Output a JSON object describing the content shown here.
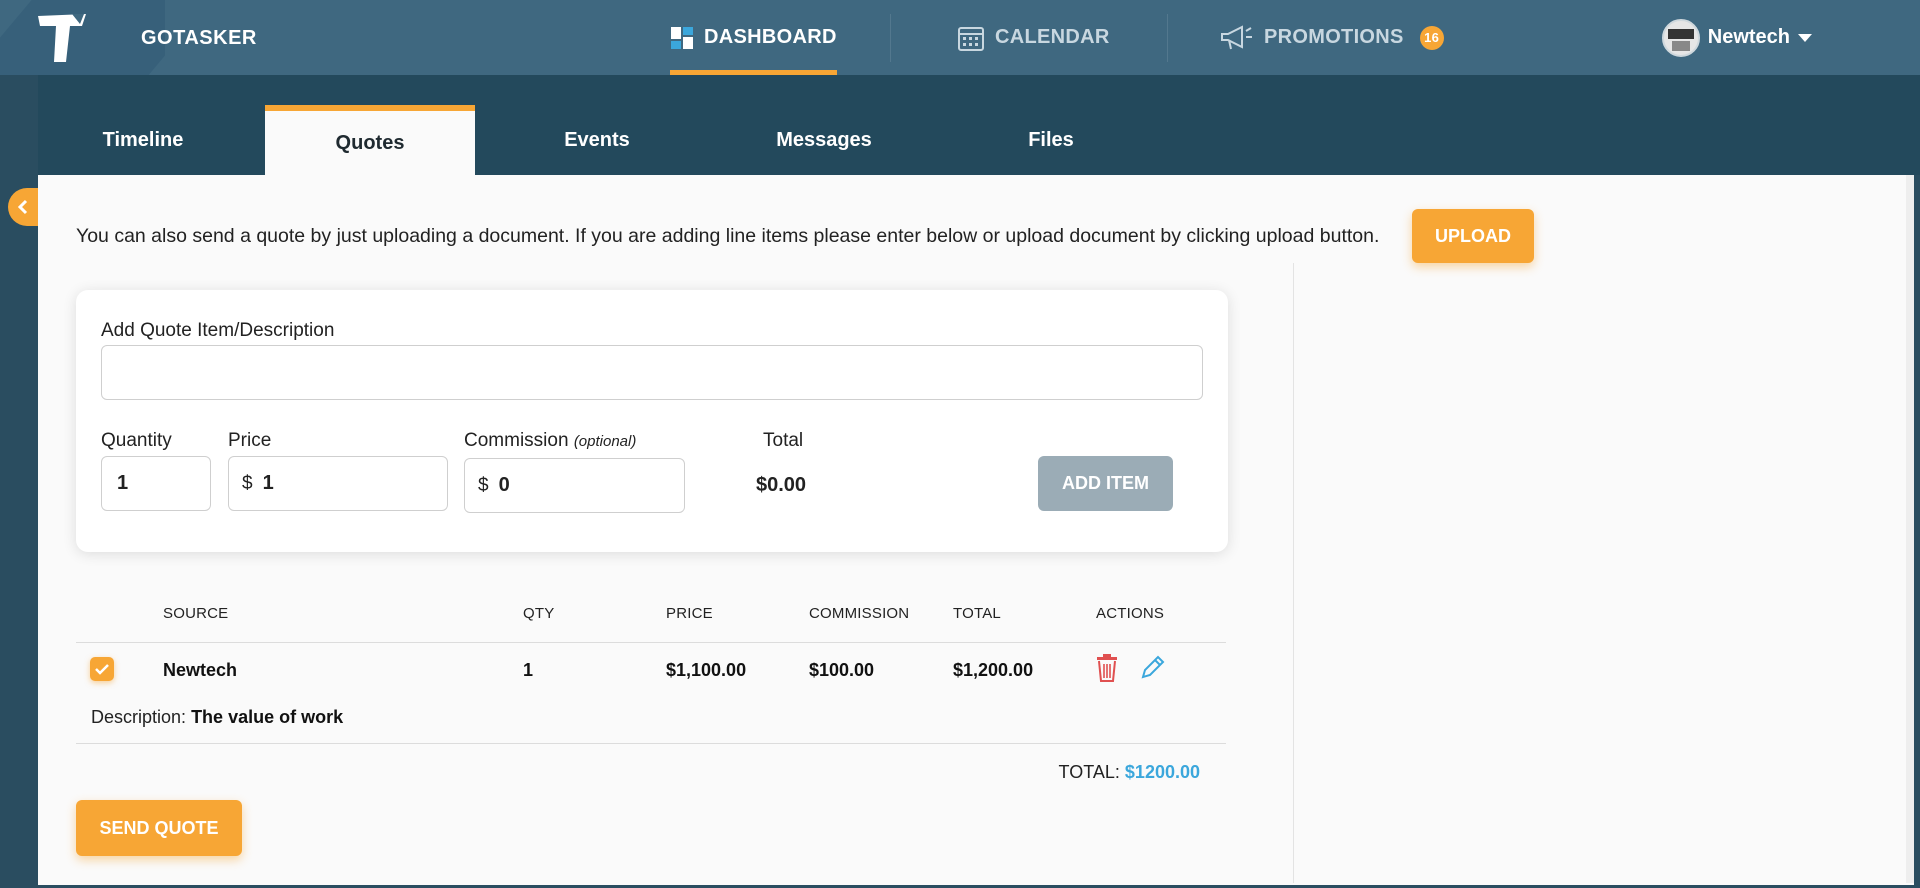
{
  "app": {
    "brand": "GOTASKER"
  },
  "nav": {
    "dashboard": "DASHBOARD",
    "calendar": "CALENDAR",
    "promotions": "PROMOTIONS",
    "promotions_badge": "16",
    "user_name": "Newtech"
  },
  "tabs": [
    "Timeline",
    "Quotes",
    "Events",
    "Messages",
    "Files"
  ],
  "active_tab": "Quotes",
  "intro_text": "You can also send a quote by just uploading a document. If you are adding line items please enter below or upload document by clicking upload button.",
  "upload_label": "UPLOAD",
  "form": {
    "item_label": "Add Quote Item/Description",
    "item_value": "",
    "quantity_label": "Quantity",
    "quantity_value": "1",
    "price_label": "Price",
    "price_currency": "$",
    "price_value": "1",
    "commission_label": "Commission",
    "commission_optional": "(optional)",
    "commission_currency": "$",
    "commission_value": "0",
    "total_label": "Total",
    "total_value": "$0.00",
    "add_item_label": "ADD ITEM"
  },
  "table": {
    "headers": [
      "SOURCE",
      "QTY",
      "PRICE",
      "COMMISSION",
      "TOTAL",
      "ACTIONS"
    ],
    "rows": [
      {
        "source": "Newtech",
        "qty": "1",
        "price": "$1,100.00",
        "commission": "$100.00",
        "total": "$1,200.00",
        "description_label": "Description:",
        "description": "The value of work"
      }
    ],
    "grand_total_label": "TOTAL:",
    "grand_total_value": "$1200.00"
  },
  "send_quote_label": "SEND QUOTE",
  "colors": {
    "accent": "#f7a635",
    "nav_bg": "#3f6880",
    "tabbar_bg": "#23495c",
    "link": "#3ba7dc"
  }
}
